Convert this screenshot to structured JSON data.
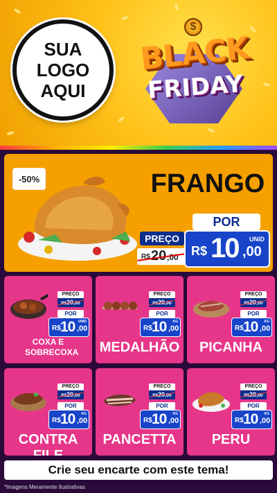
{
  "header": {
    "logo_lines": [
      "SUA",
      "LOGO",
      "AQUI"
    ],
    "promo_line1": "BLACK",
    "promo_line2": "FRIDAY",
    "coin_symbol": "$"
  },
  "hero": {
    "discount": "-50%",
    "title": "FRANGO",
    "preco_label": "PREÇO",
    "old_price_currency": "R$",
    "old_price_int": "20",
    "old_price_dec": ",00",
    "por_label": "POR",
    "new_price_currency": "R$",
    "new_price_int": "10",
    "new_price_dec": ",00",
    "unit": "UNID",
    "bg_color": "#f6a000"
  },
  "products": [
    {
      "name": "COXA E SOBRECOXA",
      "preco_label": "PREÇO",
      "old_cur": "R$",
      "old_int": "20",
      "old_dec": ",00",
      "por_label": "POR",
      "new_cur": "R$",
      "new_int": "10",
      "new_dec": ",00",
      "unit": "UNID"
    },
    {
      "name": "MEDALHÃO",
      "preco_label": "PREÇO",
      "old_cur": "R$",
      "old_int": "20",
      "old_dec": ",00",
      "por_label": "POR",
      "new_cur": "R$",
      "new_int": "10",
      "new_dec": ",00",
      "unit": "KG"
    },
    {
      "name": "PICANHA",
      "preco_label": "PREÇO",
      "old_cur": "R$",
      "old_int": "20",
      "old_dec": ",00",
      "por_label": "POR",
      "new_cur": "R$",
      "new_int": "10",
      "new_dec": ",00",
      "unit": "KG"
    },
    {
      "name": "CONTRA FILE",
      "preco_label": "PREÇO",
      "old_cur": "R$",
      "old_int": "20",
      "old_dec": ",00",
      "por_label": "POR",
      "new_cur": "R$",
      "new_int": "10",
      "new_dec": ",00",
      "unit": "KG"
    },
    {
      "name": "PANCETTA",
      "preco_label": "PREÇO",
      "old_cur": "R$",
      "old_int": "20",
      "old_dec": ",00",
      "por_label": "POR",
      "new_cur": "R$",
      "new_int": "10",
      "new_dec": ",00",
      "unit": "KG"
    },
    {
      "name": "PERU",
      "preco_label": "PREÇO",
      "old_cur": "R$",
      "old_int": "20",
      "old_dec": ",00",
      "por_label": "POR",
      "new_cur": "R$",
      "new_int": "10",
      "new_dec": ",00",
      "unit": "KG"
    }
  ],
  "cta": "Crie seu encarte com este tema!",
  "footnote": "*Imagens Meramente Ilustrativas",
  "colors": {
    "card": "#e6368a",
    "price_blue": "#1744c9",
    "tag_navy": "#0b2d8c",
    "accent": "#ffc21a"
  }
}
